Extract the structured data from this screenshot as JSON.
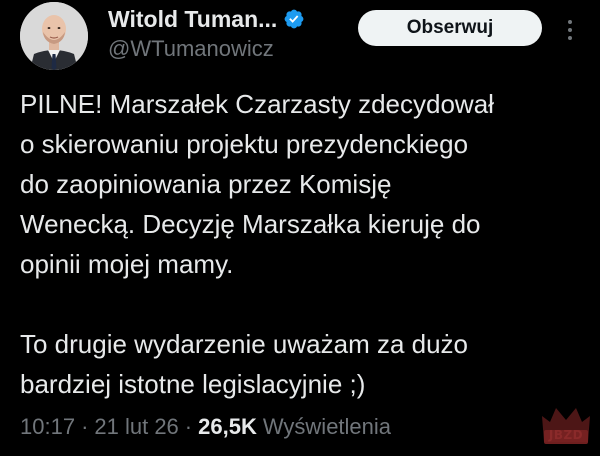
{
  "author": {
    "display_name": "Witold Tuman...",
    "handle": "@WTumanowicz",
    "verified": true
  },
  "actions": {
    "follow_label": "Obserwuj",
    "more_icon": "more-vertical-icon"
  },
  "tweet": {
    "lines_paragraph_1": [
      "PILNE! Marszałek Czarzasty zdecydował",
      "o skierowaniu projektu prezydenckiego",
      "do zaopiniowania przez Komisję",
      "Wenecką. Decyzję Marszałka kieruję do",
      "opinii mojej mamy."
    ],
    "lines_paragraph_2": [
      "To drugie wydarzenie uważam za dużo",
      "bardziej istotne legislacyjnie ;)"
    ]
  },
  "meta": {
    "time": "10:17",
    "date": "21 lut 26",
    "separator": "·",
    "views_count": "26,5K",
    "views_label": "Wyświetlenia"
  },
  "watermark": {
    "text": "JBZD"
  },
  "colors": {
    "background": "#000000",
    "text": "#e7e9ea",
    "muted": "#71767b",
    "verified": "#1d9bf0",
    "follow_bg": "#eff3f4"
  }
}
